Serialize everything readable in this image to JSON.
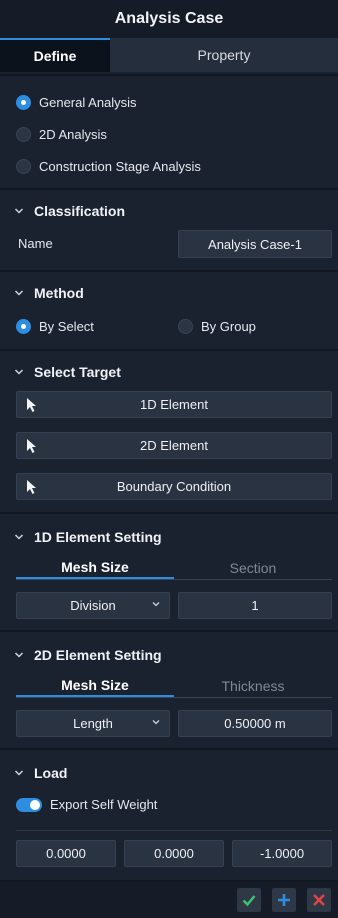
{
  "window": {
    "title": "Analysis Case"
  },
  "tabs": {
    "define": "Define",
    "property": "Property"
  },
  "analysis_type": {
    "options": [
      "General Analysis",
      "2D Analysis",
      "Construction Stage Analysis"
    ],
    "selected": "General Analysis"
  },
  "classification": {
    "header": "Classification",
    "name_label": "Name",
    "name_value": "Analysis Case-1"
  },
  "method": {
    "header": "Method",
    "by_select": "By Select",
    "by_group": "By Group",
    "selected": "By Select"
  },
  "select_target": {
    "header": "Select Target",
    "buttons": [
      "1D Element",
      "2D Element",
      "Boundary Condition"
    ]
  },
  "element_1d": {
    "header": "1D Element Setting",
    "tab_mesh": "Mesh Size",
    "tab_section": "Section",
    "type_value": "Division",
    "value": "1"
  },
  "element_2d": {
    "header": "2D Element Setting",
    "tab_mesh": "Mesh Size",
    "tab_thickness": "Thickness",
    "type_value": "Length",
    "value": "0.50000 m"
  },
  "load": {
    "header": "Load",
    "toggle_label": "Export Self Weight",
    "toggle_on": true,
    "values": [
      "0.0000",
      "0.0000",
      "-1.0000"
    ]
  },
  "colors": {
    "accent": "#2d8ee0",
    "ok": "#3ec46d",
    "add": "#2d8ee0",
    "cancel": "#e64545",
    "panel": "#1a2230"
  }
}
